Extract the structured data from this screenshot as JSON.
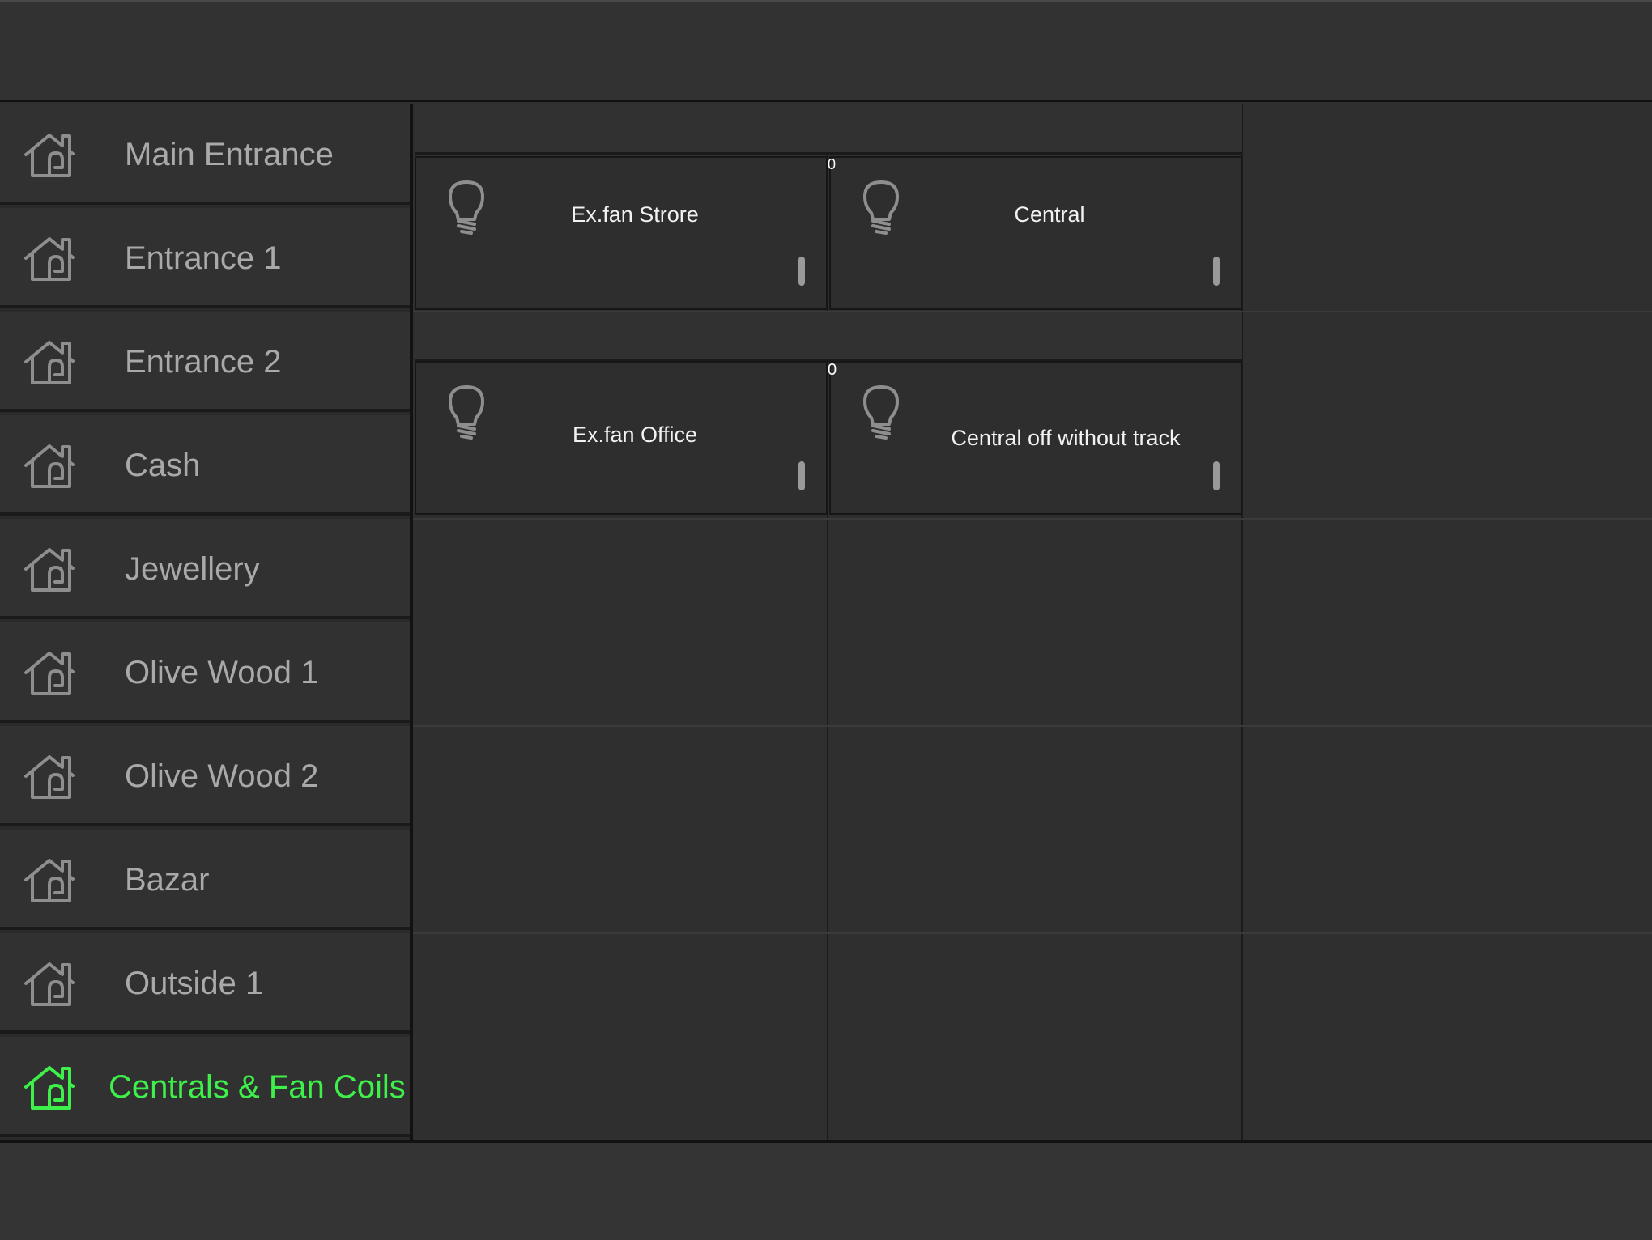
{
  "sidebar": {
    "rooms": [
      {
        "label": "Main Entrance",
        "icon": "house-icon"
      },
      {
        "label": "Entrance 1",
        "icon": "house-icon"
      },
      {
        "label": "Entrance 2",
        "icon": "house-icon"
      },
      {
        "label": "Cash",
        "icon": "house-icon"
      },
      {
        "label": "Jewellery",
        "icon": "house-icon"
      },
      {
        "label": "Olive Wood 1",
        "icon": "house-icon"
      },
      {
        "label": "Olive Wood 2",
        "icon": "house-icon"
      },
      {
        "label": "Bazar",
        "icon": "house-icon"
      },
      {
        "label": "Outside 1",
        "icon": "house-icon"
      },
      {
        "label": "Centrals & Fan Coils",
        "icon": "house-icon",
        "active": true
      }
    ]
  },
  "devices": [
    {
      "name": "Ex.fan Strore",
      "icon": "lightbulb-icon"
    },
    {
      "name": "Central",
      "icon": "lightbulb-icon",
      "count": "0"
    },
    {
      "name": "Ex.fan Office",
      "icon": "lightbulb-icon"
    },
    {
      "name": "Central off without track",
      "icon": "lightbulb-icon",
      "count": "0"
    }
  ],
  "colors": {
    "background": "#2f2f2f",
    "active_accent": "#3ef04a",
    "inactive_text": "#a9a9a9"
  }
}
